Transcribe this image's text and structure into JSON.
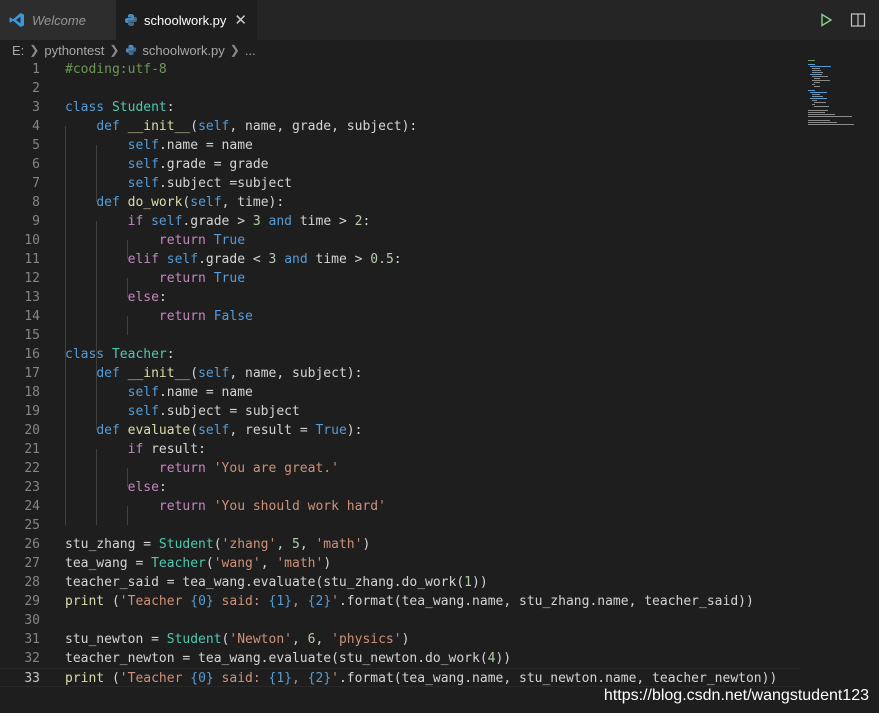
{
  "tabs": [
    {
      "label": "Welcome",
      "icon": "vscode-logo-icon",
      "active": false
    },
    {
      "label": "schoolwork.py",
      "icon": "python-icon",
      "active": true,
      "close": "✕"
    }
  ],
  "breadcrumb": [
    "E:",
    "pythontest",
    "schoolwork.py",
    "..."
  ],
  "editor": {
    "line_numbers": [
      "1",
      "2",
      "3",
      "4",
      "5",
      "6",
      "7",
      "8",
      "9",
      "10",
      "11",
      "12",
      "13",
      "14",
      "15",
      "16",
      "17",
      "18",
      "19",
      "20",
      "21",
      "22",
      "23",
      "24",
      "25",
      "26",
      "27",
      "28",
      "29",
      "30",
      "31",
      "32",
      "33"
    ],
    "lines": [
      "#coding:utf-8",
      "",
      "class Student:",
      "    def __init__(self, name, grade, subject):",
      "        self.name = name",
      "        self.grade = grade",
      "        self.subject =subject",
      "    def do_work(self, time):",
      "        if self.grade > 3 and time > 2:",
      "            return True",
      "        elif self.grade < 3 and time > 0.5:",
      "            return True",
      "        else:",
      "            return False",
      "",
      "class Teacher:",
      "    def __init__(self, name, subject):",
      "        self.name = name",
      "        self.subject = subject",
      "    def evaluate(self, result = True):",
      "        if result:",
      "            return 'You are great.'",
      "        else:",
      "            return 'You should work hard'",
      "",
      "stu_zhang = Student('zhang', 5, 'math')",
      "tea_wang = Teacher('wang', 'math')",
      "teacher_said = tea_wang.evaluate(stu_zhang.do_work(1))",
      "print ('Teacher {0} said: {1}, {2}'.format(tea_wang.name, stu_zhang.name, teacher_said))",
      "",
      "stu_newton = Student('Newton', 6, 'physics')",
      "teacher_newton = tea_wang.evaluate(stu_newton.do_work(4))",
      "print ('Teacher {0} said: {1}, {2}'.format(tea_wang.name, stu_newton.name, teacher_newton))"
    ]
  },
  "watermark": "https://blog.csdn.net/wangstudent123",
  "colors": {
    "background": "#1e1e1e",
    "keyword": "#569cd6",
    "control": "#c586c0",
    "class": "#4ec9b0",
    "function": "#dcdcaa",
    "param": "#9cdcfe",
    "string": "#ce9178",
    "number": "#b5cea8",
    "comment": "#6a9955"
  }
}
